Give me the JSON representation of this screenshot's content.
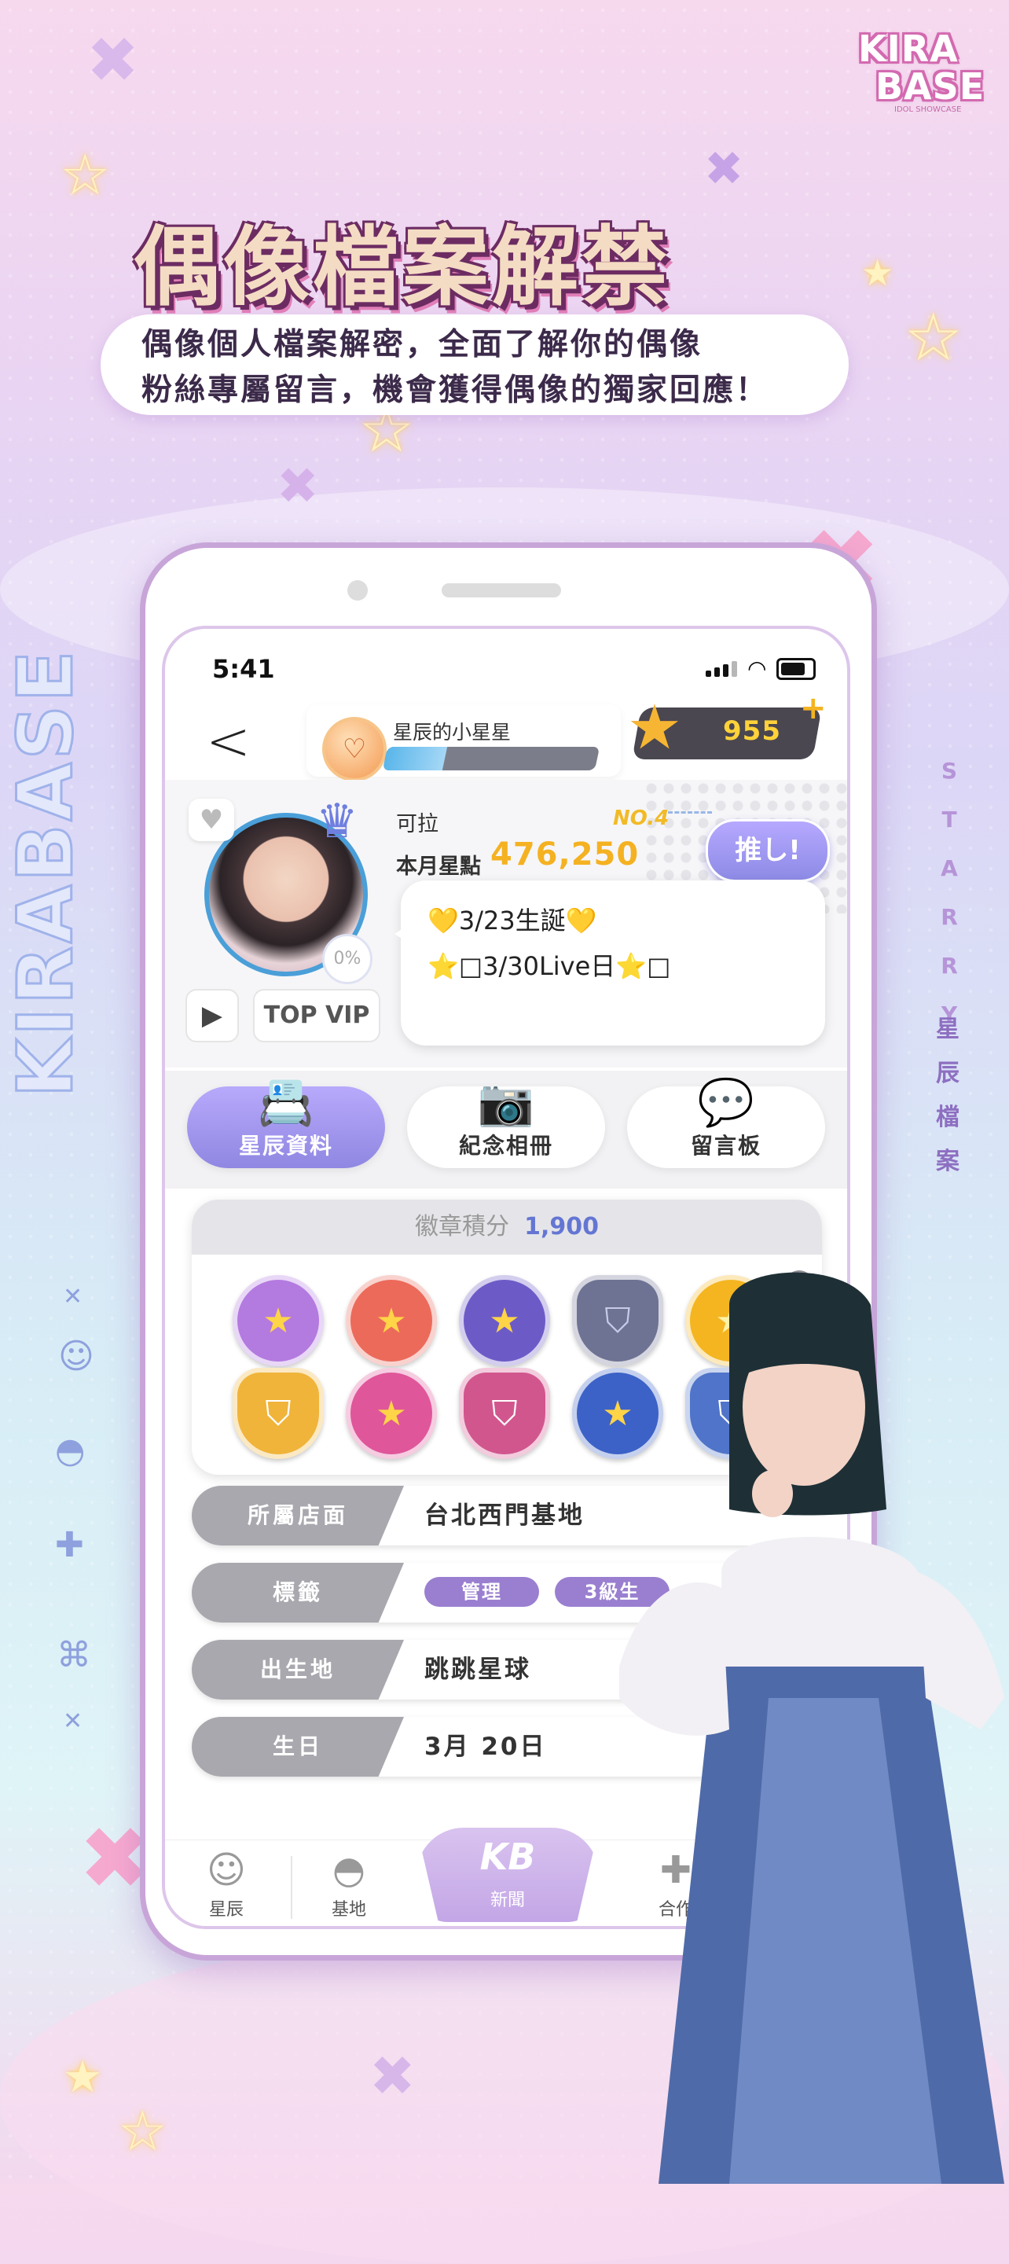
{
  "brand": {
    "logo_line1": "KIRA",
    "logo_line2": "BASE",
    "logo_tag": "IDOL SHOWCASE",
    "vertical_text": "KIRABASE",
    "starry": [
      "S",
      "T",
      "A",
      "R",
      "R",
      "Y"
    ],
    "side_vertical": [
      "星",
      "辰",
      "檔",
      "案"
    ]
  },
  "headline": "偶像檔案解禁",
  "subtitle": {
    "line1": "偶像個人檔案解密，全面了解你的偶像",
    "line2": "粉絲專屬留言，機會獲得偶像的獨家回應！"
  },
  "status_bar": {
    "time": "5:41"
  },
  "header": {
    "back_icon": "chevron-left",
    "rank_title": "星辰的小星星",
    "rank_progress": 0.28,
    "coins": "955"
  },
  "profile": {
    "name": "可拉",
    "rank_no": "NO.4",
    "stars_label": "本月星點",
    "stars_value": "476,250",
    "oshi_button": "推し!",
    "percent": "0%",
    "vip_label": "TOP VIP",
    "bubble_line1": "💛3/23生誕💛",
    "bubble_line2": "⭐□3/30Live日⭐□"
  },
  "tabs": [
    {
      "label": "星辰資料",
      "icon": "profile-card-icon",
      "active": true
    },
    {
      "label": "紀念相冊",
      "icon": "camera-icon",
      "active": false
    },
    {
      "label": "留言板",
      "icon": "message-icon",
      "active": false
    }
  ],
  "badges": {
    "label": "徽章積分",
    "score": "1,900"
  },
  "info_rows": [
    {
      "label": "所屬店面",
      "value": "台北西門基地"
    },
    {
      "label": "標籤",
      "tags": [
        "管理",
        "3級生"
      ]
    },
    {
      "label": "出生地",
      "value": "跳跳星球"
    },
    {
      "label": "生日",
      "value": "3月 20日"
    }
  ],
  "nav": [
    {
      "label": "星辰",
      "icon": "idol-icon"
    },
    {
      "label": "基地",
      "icon": "ufo-icon"
    },
    {
      "label": "新聞",
      "icon": "kb-logo-icon"
    },
    {
      "label": "合作",
      "icon": "gamepad-icon"
    }
  ],
  "colors": {
    "accent": "#8f87e2",
    "gold": "#f4b121",
    "blue": "#4a9fd8",
    "pink": "#f6a9cf"
  }
}
